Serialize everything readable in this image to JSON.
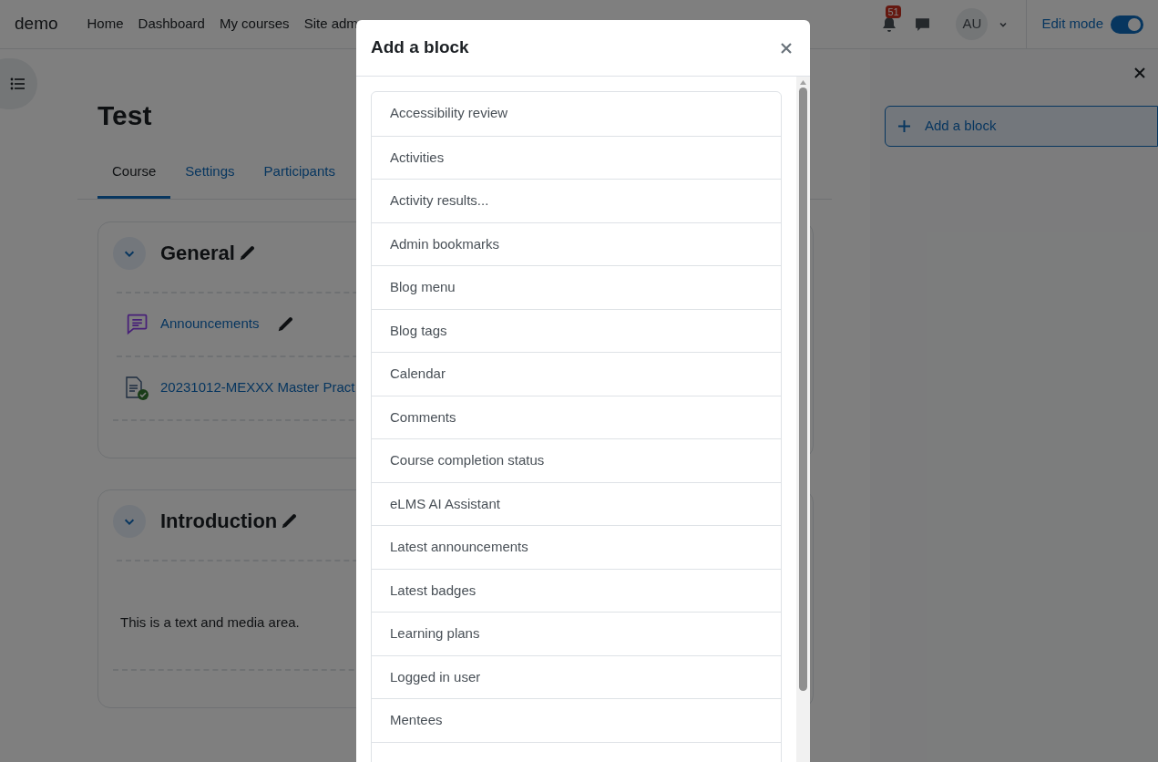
{
  "site_name": "demo",
  "nav": [
    {
      "label": "Home"
    },
    {
      "label": "Dashboard"
    },
    {
      "label": "My courses"
    },
    {
      "label": "Site adm"
    }
  ],
  "notifications": {
    "count": "51"
  },
  "user": {
    "initials": "AU"
  },
  "edit_mode": {
    "label": "Edit mode",
    "on": true
  },
  "course": {
    "title": "Test",
    "tabs": [
      {
        "label": "Course",
        "selected": true
      },
      {
        "label": "Settings",
        "selected": false
      },
      {
        "label": "Participants",
        "selected": false
      }
    ]
  },
  "sections": [
    {
      "title": "General",
      "expanded": true,
      "items": [
        {
          "kind": "forum",
          "label": "Announcements"
        },
        {
          "kind": "file",
          "label": "20231012-MEXXX Master Pract",
          "completed": true
        }
      ]
    },
    {
      "title": "Introduction",
      "expanded": true,
      "items": [
        {
          "kind": "text",
          "label": "This is a text and media area."
        }
      ]
    }
  ],
  "block_drawer": {
    "add_label": "Add a block"
  },
  "modal": {
    "title": "Add a block",
    "blocks": [
      {
        "label": "Accessibility review"
      },
      {
        "label": "Activities"
      },
      {
        "label": "Activity results..."
      },
      {
        "label": "Admin bookmarks"
      },
      {
        "label": "Blog menu"
      },
      {
        "label": "Blog tags"
      },
      {
        "label": "Calendar"
      },
      {
        "label": "Comments"
      },
      {
        "label": "Course completion status"
      },
      {
        "label": "eLMS AI Assistant"
      },
      {
        "label": "Latest announcements"
      },
      {
        "label": "Latest badges"
      },
      {
        "label": "Learning plans"
      },
      {
        "label": "Logged in user"
      },
      {
        "label": "Mentees"
      }
    ]
  }
}
